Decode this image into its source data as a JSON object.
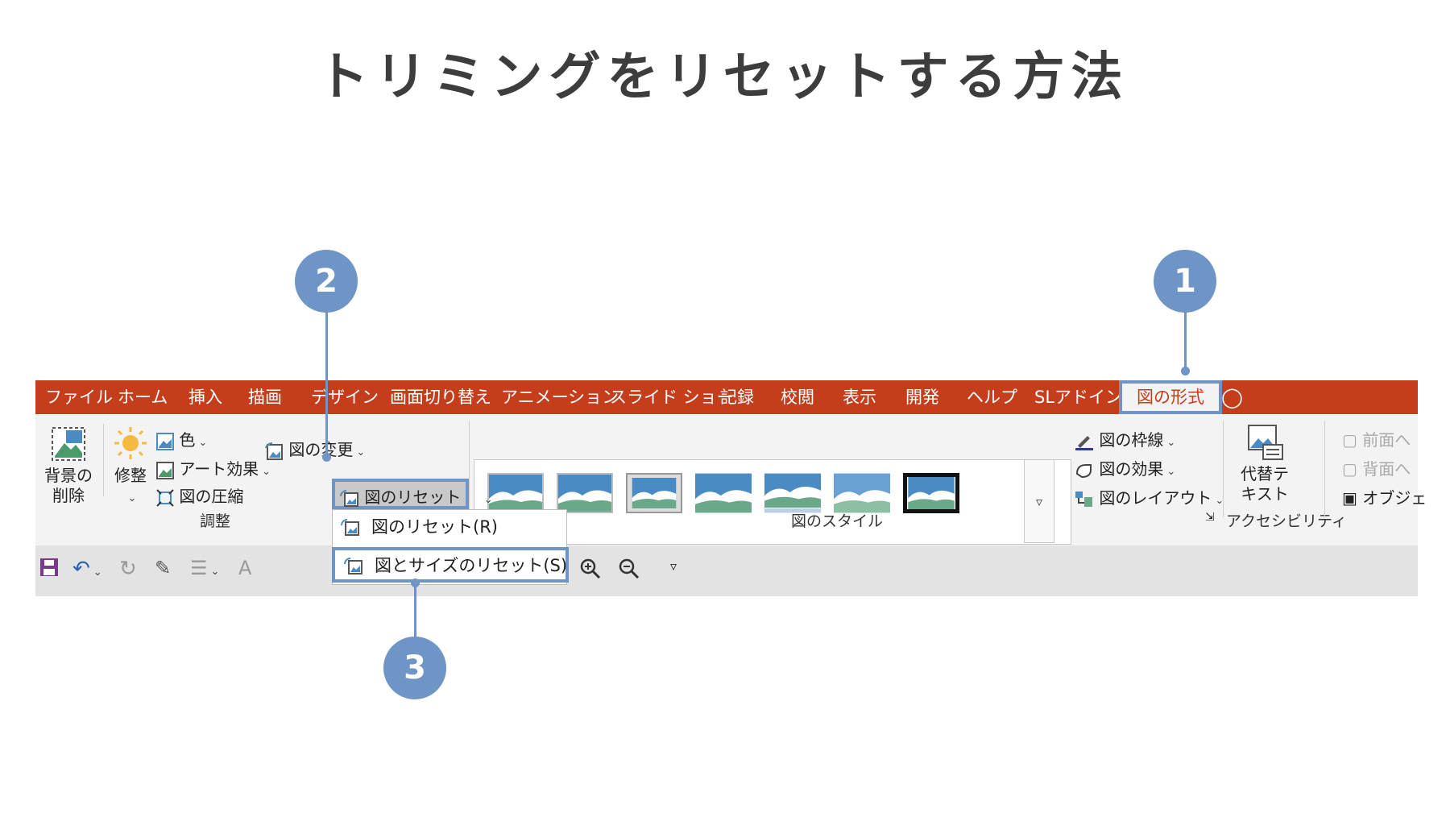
{
  "title": "トリミングをリセットする方法",
  "tabs": [
    "ファイル",
    "ホーム",
    "挿入",
    "描画",
    "デザイン",
    "画面切り替え",
    "アニメーション",
    "スライド ショー",
    "記録",
    "校閲",
    "表示",
    "開発",
    "ヘルプ",
    "SLアドイン"
  ],
  "active_tab": "図の形式",
  "adjust": {
    "remove_bg": "背景の\n削除",
    "corrections": "修整",
    "color": "色",
    "artistic": "アート効果",
    "compress": "図の圧縮",
    "change": "図の変更",
    "reset": "図のリセット",
    "group_label": "調整"
  },
  "menu": {
    "reset_picture": "図のリセット(R)",
    "reset_picture_size": "図とサイズのリセット(S)"
  },
  "styles": {
    "border": "図の枠線",
    "effects": "図の効果",
    "layout": "図のレイアウト",
    "group_label": "図のスタイル"
  },
  "accessibility": {
    "alt_text": "代替テ\nキスト",
    "group_label": "アクセシビリティ"
  },
  "arrange": {
    "bring_forward": "前面へ",
    "send_backward": "背面へ",
    "selection": "オブジェ"
  },
  "callouts": [
    "1",
    "2",
    "3"
  ],
  "colors": {
    "tabbar": "#c43e1c",
    "accent": "#6f95c7"
  }
}
